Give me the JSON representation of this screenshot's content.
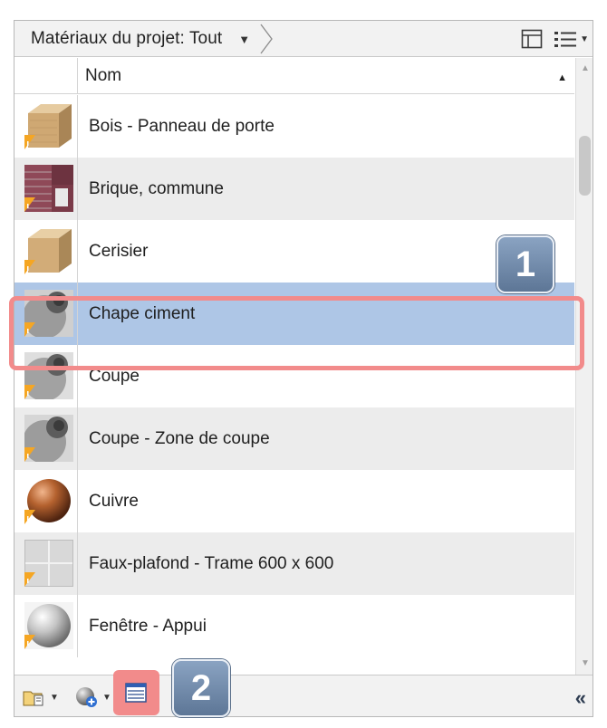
{
  "toolbar": {
    "breadcrumb": "Matériaux du projet: Tout",
    "breadcrumb_dropdown_icon": "triangle-down"
  },
  "header": {
    "name_column": "Nom",
    "sort_icon": "sort-ascending"
  },
  "materials": [
    {
      "label": "",
      "thumb": "wood-box"
    },
    {
      "label": "Bois - Panneau de porte",
      "thumb": "wood-box"
    },
    {
      "label": "Brique, commune",
      "thumb": "brick"
    },
    {
      "label": "Cerisier",
      "thumb": "wood-box"
    },
    {
      "label": "Chape ciment",
      "thumb": "grey-sphere"
    },
    {
      "label": "Coupe",
      "thumb": "grey-sphere"
    },
    {
      "label": "Coupe - Zone de coupe",
      "thumb": "grey-sphere"
    },
    {
      "label": "Cuivre",
      "thumb": "copper-sphere"
    },
    {
      "label": "Faux-plafond - Trame 600 x 600",
      "thumb": "ceiling-grid"
    },
    {
      "label": "Fenêtre - Appui",
      "thumb": "white-sphere"
    }
  ],
  "selected_index": 4,
  "callouts": {
    "one": "1",
    "two": "2"
  },
  "colors": {
    "selection": "#aec6e6",
    "highlight": "#f28b8b",
    "badge": "#6f88a8",
    "warning": "#f5a623"
  },
  "bottombar": {
    "collapse_label": "«"
  }
}
